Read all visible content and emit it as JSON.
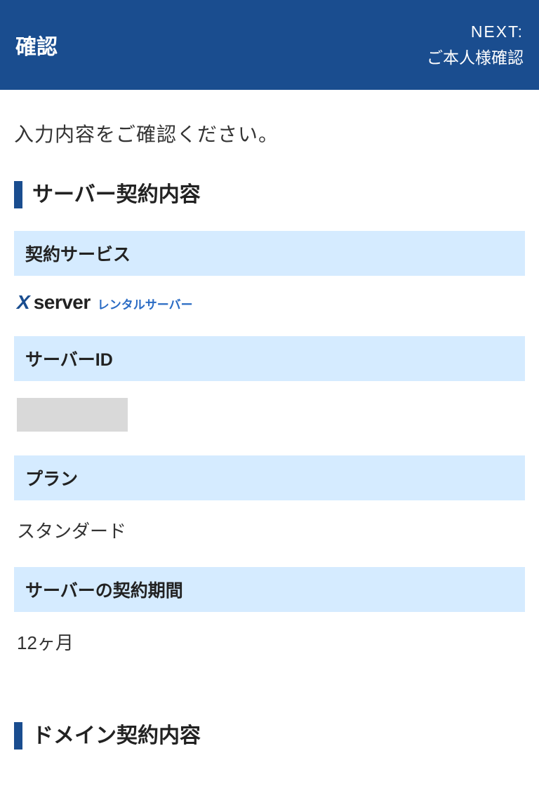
{
  "header": {
    "title": "確認",
    "next_label": "NEXT:",
    "next_value": "ご本人様確認"
  },
  "instruction": "入力内容をご確認ください。",
  "sections": {
    "server": {
      "title": "サーバー契約内容",
      "fields": {
        "service_label": "契約サービス",
        "service_logo_x": "X",
        "service_logo_server": "server",
        "service_logo_sub": "レンタルサーバー",
        "id_label": "サーバーID",
        "plan_label": "プラン",
        "plan_value": "スタンダード",
        "term_label": "サーバーの契約期間",
        "term_value": "12ヶ月"
      }
    },
    "domain": {
      "title": "ドメイン契約内容"
    }
  }
}
